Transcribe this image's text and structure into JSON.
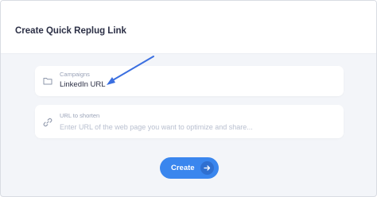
{
  "dialog": {
    "title": "Create Quick Replug Link"
  },
  "campaign_field": {
    "label": "Campaigns",
    "value": "LinkedIn URL",
    "icon": "folder-icon"
  },
  "url_field": {
    "label": "URL to shorten",
    "placeholder": "Enter URL of the web page you want to optimize and share...",
    "icon": "link-icon"
  },
  "create_button": {
    "label": "Create",
    "icon": "arrow-right-icon"
  },
  "colors": {
    "accent": "#3a86ee",
    "annotation_arrow": "#3b6fe0",
    "title": "#2b2f45",
    "background": "#f3f5f9"
  }
}
